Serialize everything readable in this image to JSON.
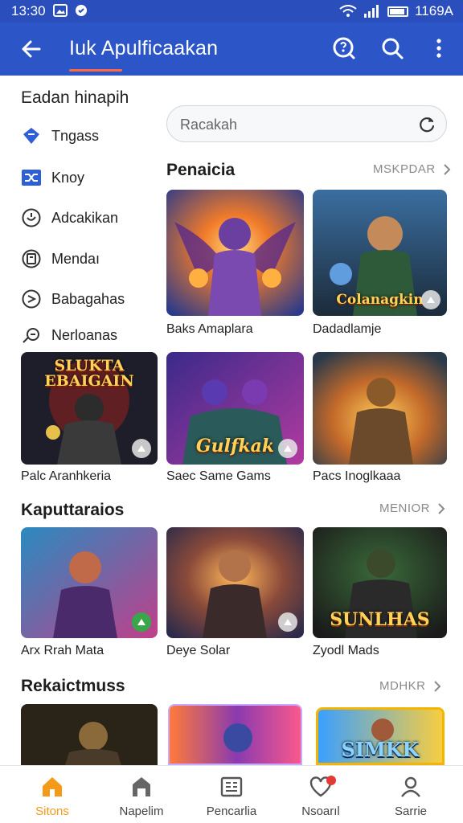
{
  "status": {
    "time": "13:30",
    "right_text": "1169A"
  },
  "appbar": {
    "title": "Iuk Apulficaakan"
  },
  "sidebar": {
    "title": "Eadan hinapih",
    "items": [
      {
        "label": "Tngass",
        "icon": "shield-icon"
      },
      {
        "label": "Knoy",
        "icon": "shuffle-icon"
      },
      {
        "label": "Adcakikan",
        "icon": "clock-icon"
      },
      {
        "label": "Mendaı",
        "icon": "tablet-icon"
      },
      {
        "label": "Babagahas",
        "icon": "compass-icon"
      },
      {
        "label": "Nerloanas",
        "icon": "chat-icon"
      }
    ]
  },
  "search": {
    "placeholder": "Racakah"
  },
  "sections": [
    {
      "title": "Penaicia",
      "more": "MSKPDAR"
    },
    {
      "title": "Kaputtaraios",
      "more": "MENIOR"
    },
    {
      "title": "Rekaictmuss",
      "more": "MDHKR"
    }
  ],
  "cards": [
    {
      "caption": "Baks Amaplara"
    },
    {
      "caption": "Dadadlamje",
      "art_text": "Colanagkin"
    },
    {
      "caption": "Palc Aranhkeria",
      "art_text": "SLUKTA EBAIGAIN"
    },
    {
      "caption": "Saec Same Gams",
      "art_text": "Gulfkak"
    },
    {
      "caption": "Pacs Inoglkaaa"
    },
    {
      "caption": "Arx Rrah Mata"
    },
    {
      "caption": "Deye Solar"
    },
    {
      "caption": "Zyodl Mads",
      "art_text": "SUNLHAS"
    },
    {
      "caption": ""
    },
    {
      "caption": ""
    },
    {
      "caption": "",
      "art_text": "SIMKK"
    }
  ],
  "bottom_nav": [
    {
      "label": "Sitons",
      "icon": "home-icon",
      "active": true
    },
    {
      "label": "Napelim",
      "icon": "store-icon",
      "active": false
    },
    {
      "label": "Pencarlia",
      "icon": "grid-icon",
      "active": false
    },
    {
      "label": "Nsoarıl",
      "icon": "heart-icon",
      "active": false,
      "badge": true
    },
    {
      "label": "Sarrie",
      "icon": "person-icon",
      "active": false
    }
  ],
  "colors": {
    "appbar": "#2c55c8",
    "accent": "#f39a1a",
    "underline": "#ff6a3d"
  }
}
